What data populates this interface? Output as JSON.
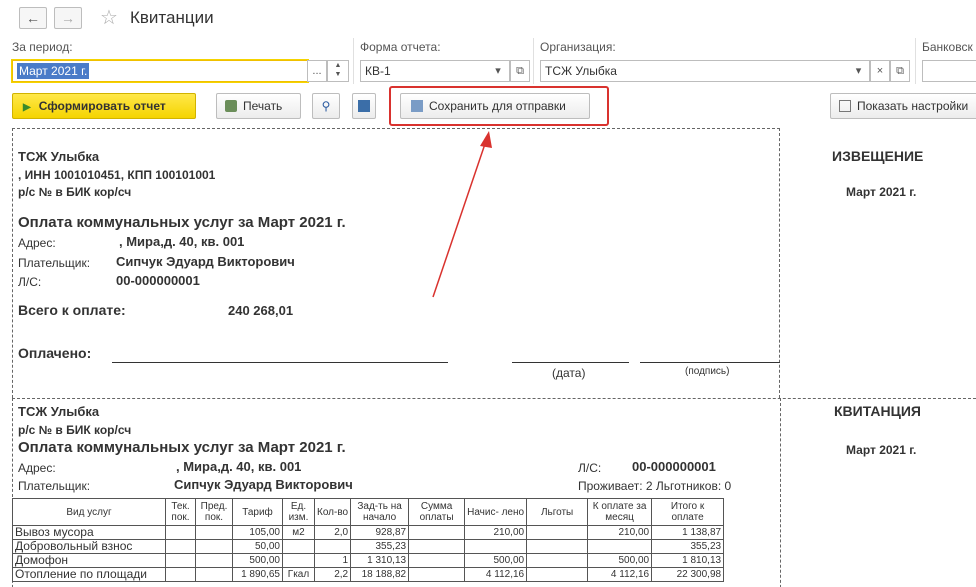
{
  "window": {
    "title": "Квитанции"
  },
  "filters": {
    "period_label": "За период:",
    "period_value": "Март 2021 г.",
    "form_label": "Форма отчета:",
    "form_value": "КВ-1",
    "org_label": "Организация:",
    "org_value": "ТСЖ Улыбка",
    "bank_label": "Банковск"
  },
  "toolbar": {
    "generate": "Сформировать отчет",
    "print": "Печать",
    "save_for_send": "Сохранить для отправки",
    "show_settings": "Показать настройки"
  },
  "notice": {
    "org": "ТСЖ Улыбка",
    "inn_line": ", ИНН 1001010451, КПП 100101001",
    "account_line": "р/с №  в  БИК  кор/сч",
    "payment_title": "Оплата коммунальных услуг за Март 2021 г.",
    "address_label": "Адрес:",
    "address_value": ", Мира,д. 40, кв. 001",
    "payer_label": "Плательщик:",
    "payer_value": "Сипчук Эдуард Викторович",
    "ls_label": "Л/С:",
    "ls_value": "00-000000001",
    "total_label": "Всего к оплате:",
    "total_value": "240 268,01",
    "paid_label": "Оплачено:",
    "date_label": "(дата)",
    "sign_label": "(подпись)",
    "side_title": "ИЗВЕЩЕНИЕ",
    "side_period": "Март 2021 г."
  },
  "receipt": {
    "org": "ТСЖ Улыбка",
    "account_line": "р/с №  в  БИК  кор/сч",
    "payment_title": "Оплата коммунальных услуг за Март 2021 г.",
    "address_label": "Адрес:",
    "address_value": ", Мира,д. 40, кв. 001",
    "payer_label": "Плательщик:",
    "payer_value": "Сипчук Эдуард Викторович",
    "ls_label": "Л/С:",
    "ls_value": "00-000000001",
    "residents": "Проживает: 2 Льготников: 0",
    "side_title": "КВИТАНЦИЯ",
    "side_period": "Март 2021 г."
  },
  "table": {
    "headers": [
      "Вид услуг",
      "Тек. пок.",
      "Пред. пок.",
      "Тариф",
      "Ед. изм.",
      "Кол-во",
      "Зад-ть на начало",
      "Сумма оплаты",
      "Начис- лено",
      "Льготы",
      "К оплате за месяц",
      "Итого к оплате"
    ],
    "rows": [
      [
        "Вывоз мусора",
        "",
        "",
        "105,00",
        "м2",
        "2,0",
        "928,87",
        "",
        "210,00",
        "",
        "210,00",
        "1 138,87"
      ],
      [
        "Добровольный взнос",
        "",
        "",
        "50,00",
        "",
        "",
        "355,23",
        "",
        "",
        "",
        "",
        "355,23"
      ],
      [
        "Домофон",
        "",
        "",
        "500,00",
        "",
        "1",
        "1 310,13",
        "",
        "500,00",
        "",
        "500,00",
        "1 810,13"
      ],
      [
        "Отопление по площади",
        "",
        "",
        "1 890,65",
        "Гкал",
        "2,2",
        "18 188,82",
        "",
        "4 112,16",
        "",
        "4 112,16",
        "22 300,98"
      ]
    ]
  },
  "colors": {
    "accent_yellow": "#f5d400",
    "highlight_red": "#d9322e",
    "selection_blue": "#4a7bc8"
  }
}
